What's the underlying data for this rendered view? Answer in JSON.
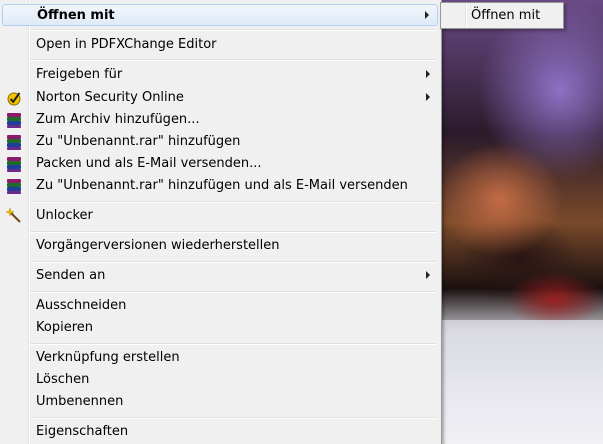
{
  "menu": {
    "items": [
      {
        "label": "Öffnen mit",
        "bold": true,
        "submenu": true,
        "icon": ""
      },
      {
        "label": "Open in PDFXChange Editor",
        "icon": ""
      },
      {
        "label": "Freigeben für",
        "submenu": true,
        "icon": ""
      },
      {
        "label": "Norton Security Online",
        "submenu": true,
        "icon": "norton-icon"
      },
      {
        "label": "Zum Archiv hinzufügen...",
        "icon": "winrar-icon"
      },
      {
        "label": "Zu \"Unbenannt.rar\" hinzufügen",
        "icon": "winrar-icon"
      },
      {
        "label": "Packen und als E-Mail versenden...",
        "icon": "winrar-icon"
      },
      {
        "label": "Zu \"Unbenannt.rar\" hinzufügen und als E-Mail versenden",
        "icon": "winrar-icon"
      },
      {
        "label": "Unlocker",
        "icon": "magic-wand-icon"
      },
      {
        "label": "Vorgängerversionen wiederherstellen",
        "icon": ""
      },
      {
        "label": "Senden an",
        "submenu": true,
        "icon": ""
      },
      {
        "label": "Ausschneiden",
        "icon": ""
      },
      {
        "label": "Kopieren",
        "icon": ""
      },
      {
        "label": "Verknüpfung erstellen",
        "icon": ""
      },
      {
        "label": "Löschen",
        "icon": ""
      },
      {
        "label": "Umbenennen",
        "icon": ""
      },
      {
        "label": "Eigenschaften",
        "icon": ""
      }
    ]
  },
  "submenu": {
    "items": [
      {
        "label": "Öffnen mit"
      }
    ]
  },
  "colors": {
    "menu_bg": "#f0f0f0",
    "highlight_border": "#aecff7",
    "highlight_fill": "#dfeaf7",
    "norton_yellow": "#f5c400"
  }
}
